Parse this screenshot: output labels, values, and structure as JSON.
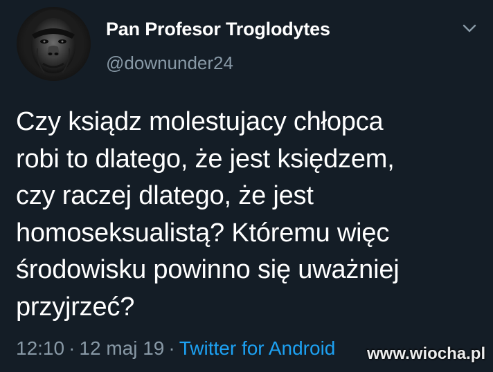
{
  "tweet": {
    "display_name": "Pan Profesor Troglodytes",
    "handle": "@downunder24",
    "text": "Czy ksiądz molestujacy chłopca\nrobi to dlatego, że jest księdzem,\nczy raczej dlatego, że jest\nhomoseksualistą? Któremu więc\nśrodowisku powinno się uważniej\nprzyjrzeć?",
    "time": "12:10",
    "date": "12 maj 19",
    "separator": "·",
    "source": "Twitter for Android",
    "menu_icon": "chevron-down-icon",
    "avatar_icon": "ape-avatar"
  },
  "watermark": "www.wiocha.pl",
  "colors": {
    "background": "#141d26",
    "primary_text": "#ffffff",
    "secondary_text": "#8899a6",
    "link": "#1da1f2"
  }
}
